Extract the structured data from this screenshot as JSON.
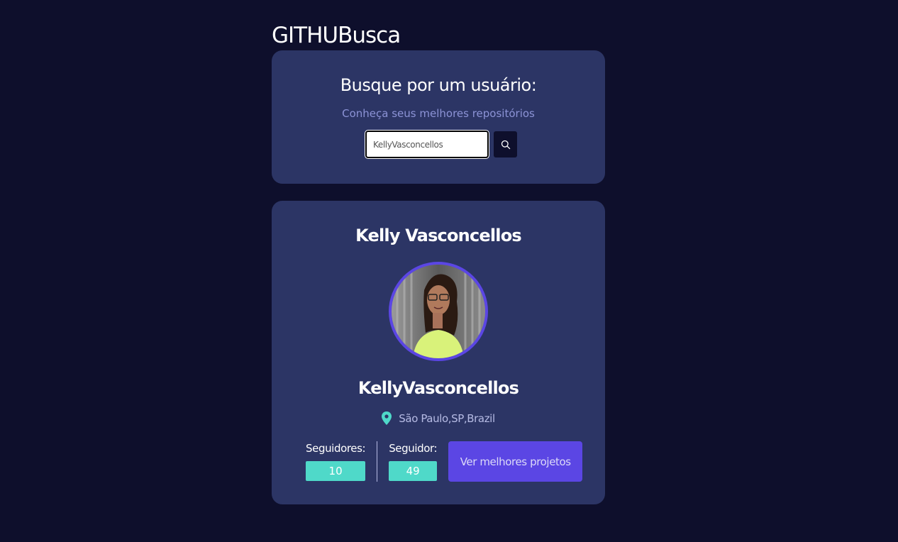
{
  "header": {
    "title": "GITHUBusca"
  },
  "search": {
    "title": "Busque por um usuário:",
    "subtitle": "Conheça seus melhores repositórios",
    "value": "KellyVasconcellos",
    "button_icon": "search-icon"
  },
  "profile": {
    "name": "Kelly Vasconcellos",
    "login": "KellyVasconcellos",
    "location": "São Paulo,SP,Brazil",
    "location_icon": "map-pin-icon",
    "followers_label": "Seguidores:",
    "followers_value": "10",
    "following_label": "Seguidor:",
    "following_value": "49",
    "projects_button": "Ver melhores projetos"
  },
  "colors": {
    "background": "#0e0f2c",
    "card": "#2c3565",
    "accent": "#5b46e4",
    "teal": "#4fd9c9"
  }
}
